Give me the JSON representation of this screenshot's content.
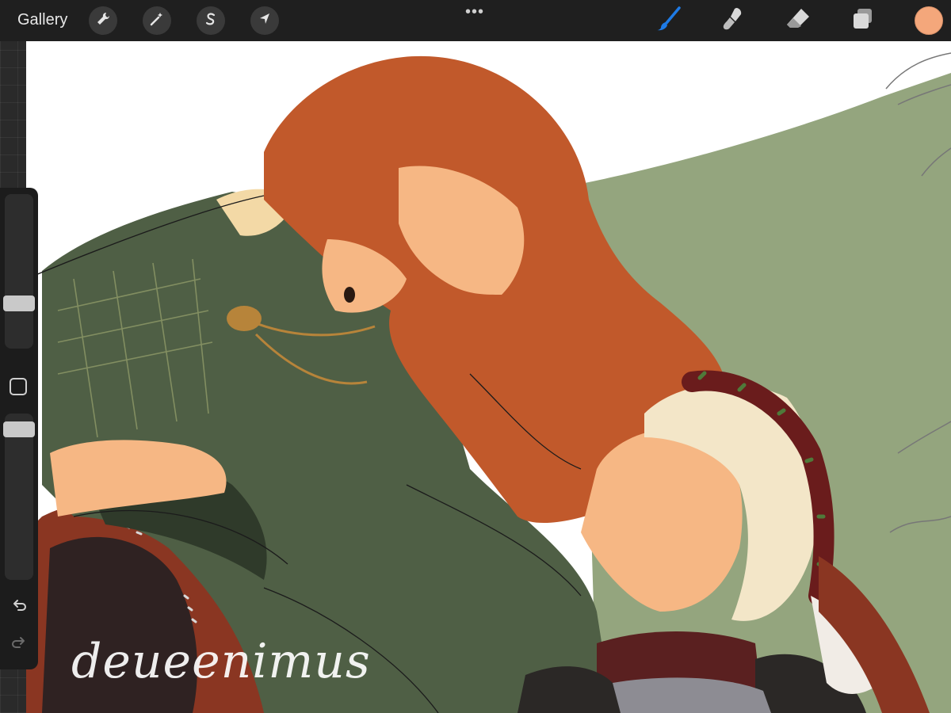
{
  "app": {
    "gallery_label": "Gallery",
    "more_dots": "•••",
    "accent_color": "#1e7be6",
    "current_color": "#f4a77b"
  },
  "top_tools": [
    {
      "name": "actions-wrench",
      "icon": "wrench-icon"
    },
    {
      "name": "adjustments-wand",
      "icon": "magic-wand-icon"
    },
    {
      "name": "selection",
      "icon": "selection-s-icon"
    },
    {
      "name": "transform",
      "icon": "arrow-cursor-icon"
    }
  ],
  "right_tools": [
    {
      "name": "brush",
      "icon": "brush-icon",
      "active": true
    },
    {
      "name": "smudge",
      "icon": "smudge-icon"
    },
    {
      "name": "eraser",
      "icon": "eraser-icon"
    },
    {
      "name": "layers",
      "icon": "layers-icon"
    }
  ],
  "sidebar": {
    "brush_size_level": 0.27,
    "opacity_level": 0.95,
    "undo_icon": "undo-arrow-icon",
    "redo_icon": "redo-arrow-icon"
  },
  "artwork": {
    "signature": "deueenimus",
    "palette": {
      "sky": "#ffffff",
      "background_green": "#94a57e",
      "dress_green": "#4f5f45",
      "hair_orange": "#c1592b",
      "skin": "#f6b784",
      "blonde_hair": "#f3e6c8",
      "cape_red": "#8a3622",
      "gold": "#b7843a",
      "roses": "#6a1c1c"
    }
  }
}
